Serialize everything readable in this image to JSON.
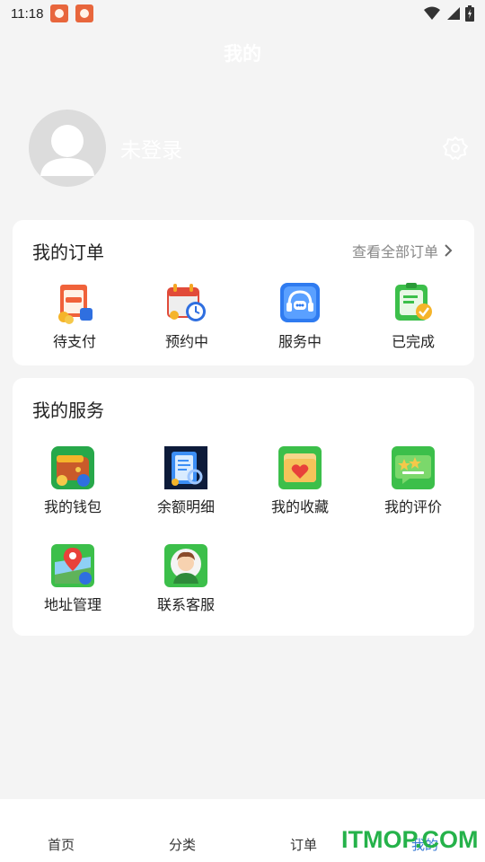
{
  "status_bar": {
    "time": "11:18"
  },
  "header": {
    "title": "我的"
  },
  "profile": {
    "login_text": "未登录"
  },
  "orders": {
    "title": "我的订单",
    "view_all": "查看全部订单",
    "items": [
      {
        "label": "待支付",
        "icon": "pending-payment-icon"
      },
      {
        "label": "预约中",
        "icon": "calendar-clock-icon"
      },
      {
        "label": "服务中",
        "icon": "headset-service-icon"
      },
      {
        "label": "已完成",
        "icon": "clipboard-check-icon"
      }
    ]
  },
  "services": {
    "title": "我的服务",
    "items": [
      {
        "label": "我的钱包",
        "icon": "wallet-icon"
      },
      {
        "label": "余额明细",
        "icon": "balance-detail-icon"
      },
      {
        "label": "我的收藏",
        "icon": "favorites-icon"
      },
      {
        "label": "我的评价",
        "icon": "review-icon"
      },
      {
        "label": "地址管理",
        "icon": "address-map-icon"
      },
      {
        "label": "联系客服",
        "icon": "customer-service-icon"
      }
    ]
  },
  "tabbar": {
    "tabs": [
      "首页",
      "分类",
      "订单",
      "我的"
    ],
    "active_index": 3
  },
  "watermark": "ITMOP.COM"
}
